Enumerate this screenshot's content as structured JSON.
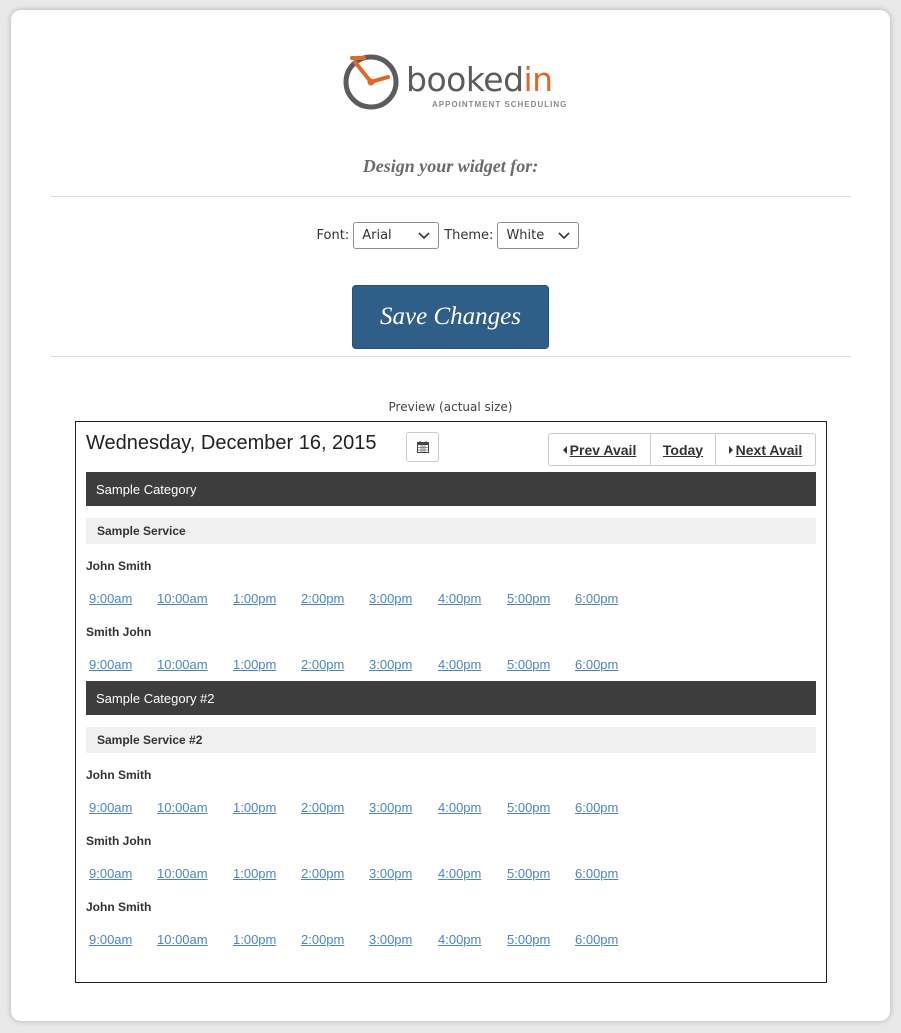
{
  "logo": {
    "brand_main": "booked",
    "brand_accent": "in",
    "tagline": "APPOINTMENT SCHEDULING",
    "accent_color": "#e0662a",
    "gray_color": "#5c5c5c"
  },
  "design_label": "Design your widget for:",
  "controls": {
    "font_label": "Font:",
    "font_value": "Arial",
    "theme_label": "Theme:",
    "theme_value": "White"
  },
  "save_button": "Save Changes",
  "preview_label": "Preview (actual size)",
  "widget": {
    "date": "Wednesday, December 16, 2015",
    "calendar_icon": "calendar-icon",
    "nav": {
      "prev": "Prev Avail",
      "today": "Today",
      "next": "Next Avail"
    },
    "categories": [
      {
        "name": "Sample Category",
        "service": "Sample Service",
        "staff": [
          {
            "name": "John Smith",
            "slots": [
              "9:00am",
              "10:00am",
              "1:00pm",
              "2:00pm",
              "3:00pm",
              "4:00pm",
              "5:00pm",
              "6:00pm"
            ]
          },
          {
            "name": "Smith John",
            "slots": [
              "9:00am",
              "10:00am",
              "1:00pm",
              "2:00pm",
              "3:00pm",
              "4:00pm",
              "5:00pm",
              "6:00pm"
            ]
          }
        ]
      },
      {
        "name": "Sample Category #2",
        "service": "Sample Service #2",
        "staff": [
          {
            "name": "John Smith",
            "slots": [
              "9:00am",
              "10:00am",
              "1:00pm",
              "2:00pm",
              "3:00pm",
              "4:00pm",
              "5:00pm",
              "6:00pm"
            ]
          },
          {
            "name": "Smith John",
            "slots": [
              "9:00am",
              "10:00am",
              "1:00pm",
              "2:00pm",
              "3:00pm",
              "4:00pm",
              "5:00pm",
              "6:00pm"
            ]
          },
          {
            "name": "John Smith",
            "slots": [
              "9:00am",
              "10:00am",
              "1:00pm",
              "2:00pm",
              "3:00pm",
              "4:00pm",
              "5:00pm",
              "6:00pm"
            ]
          }
        ]
      }
    ]
  }
}
